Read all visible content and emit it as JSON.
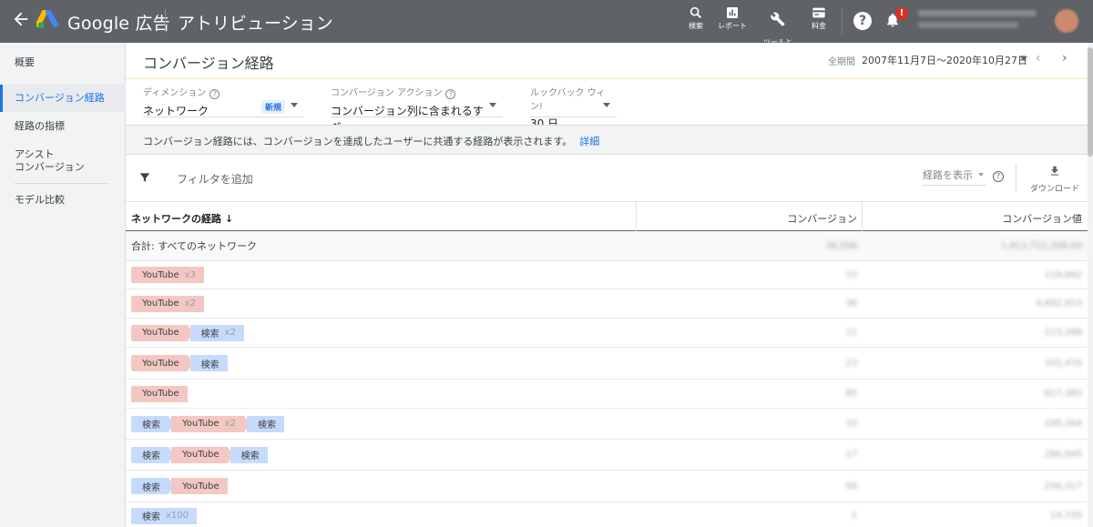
{
  "topbar": {
    "brand": "Google 広告",
    "page_title": "アトリビューション",
    "buttons": [
      {
        "label": "検索",
        "icon": "search-icon"
      },
      {
        "label": "レポート",
        "icon": "report-icon"
      },
      {
        "label": "ツールと\n設定",
        "icon": "wrench-icon"
      },
      {
        "label": "料金",
        "icon": "billing-icon"
      }
    ],
    "notification_count": "!"
  },
  "sidebar": {
    "items": [
      {
        "label": "概要"
      },
      {
        "label": "コンバージョン経路"
      },
      {
        "label": "経路の指標"
      },
      {
        "label": "アシスト\nコンバージョン"
      },
      {
        "label": "モデル比較"
      }
    ]
  },
  "header": {
    "title": "コンバージョン経路",
    "date_label": "全期間",
    "date_range": "2007年11月7日～2020年10月27日"
  },
  "selectors": {
    "dimension": {
      "label": "ディメンション",
      "value": "ネットワーク",
      "badge": "新規"
    },
    "conversion_action": {
      "label": "コンバージョン アクション",
      "value": "コンバージョン列に含まれるすべ..."
    },
    "lookback": {
      "label": "ルックバック ウィン!",
      "value": "30 日"
    }
  },
  "info": {
    "text": "コンバージョン経路には、コンバージョンを達成したユーザーに共通する経路が表示されます。",
    "link": "詳細"
  },
  "filter": {
    "add_filter": "フィルタを追加",
    "path_display": "経路を表示",
    "download": "ダウンロード"
  },
  "table": {
    "headers": {
      "path": "ネットワークの経路 ↓",
      "conversions": "コンバージョン",
      "value": "コンバージョン値"
    },
    "total_label": "合計: すべてのネットワーク",
    "total_conversions": "38,598",
    "total_value": "1,912,722,208.00",
    "rows": [
      {
        "path": [
          {
            "type": "yt",
            "label": "YouTube",
            "mult": "x3"
          }
        ],
        "conversions": "15",
        "value": "119,862"
      },
      {
        "path": [
          {
            "type": "yt",
            "label": "YouTube",
            "mult": "x2"
          }
        ],
        "conversions": "36",
        "value": "4,602,913"
      },
      {
        "path": [
          {
            "type": "yt",
            "label": "YouTube",
            "mult": ""
          },
          {
            "type": "se",
            "label": "検索",
            "mult": "x2"
          }
        ],
        "conversions": "11",
        "value": "213,268"
      },
      {
        "path": [
          {
            "type": "yt",
            "label": "YouTube",
            "mult": ""
          },
          {
            "type": "se",
            "label": "検索",
            "mult": ""
          }
        ],
        "conversions": "23",
        "value": "332,470"
      },
      {
        "path": [
          {
            "type": "yt",
            "label": "YouTube",
            "mult": ""
          }
        ],
        "conversions": "85",
        "value": "617,383"
      },
      {
        "path": [
          {
            "type": "se",
            "label": "検索",
            "mult": ""
          },
          {
            "type": "yt",
            "label": "YouTube",
            "mult": "x2"
          },
          {
            "type": "se",
            "label": "検索",
            "mult": ""
          }
        ],
        "conversions": "10",
        "value": "185,164"
      },
      {
        "path": [
          {
            "type": "se",
            "label": "検索",
            "mult": ""
          },
          {
            "type": "yt",
            "label": "YouTube",
            "mult": ""
          },
          {
            "type": "se",
            "label": "検索",
            "mult": ""
          }
        ],
        "conversions": "17",
        "value": "280,945"
      },
      {
        "path": [
          {
            "type": "se",
            "label": "検索",
            "mult": ""
          },
          {
            "type": "yt",
            "label": "YouTube",
            "mult": ""
          }
        ],
        "conversions": "48",
        "value": "256,317"
      },
      {
        "path": [
          {
            "type": "se",
            "label": "検索",
            "mult": "x100"
          }
        ],
        "conversions": "1",
        "value": "14,735"
      }
    ]
  },
  "colors": {
    "topbar": "#5f6368",
    "accent": "#1a73e8",
    "youtube_chip": "#f4c7c3",
    "search_chip": "#c6dafc"
  }
}
